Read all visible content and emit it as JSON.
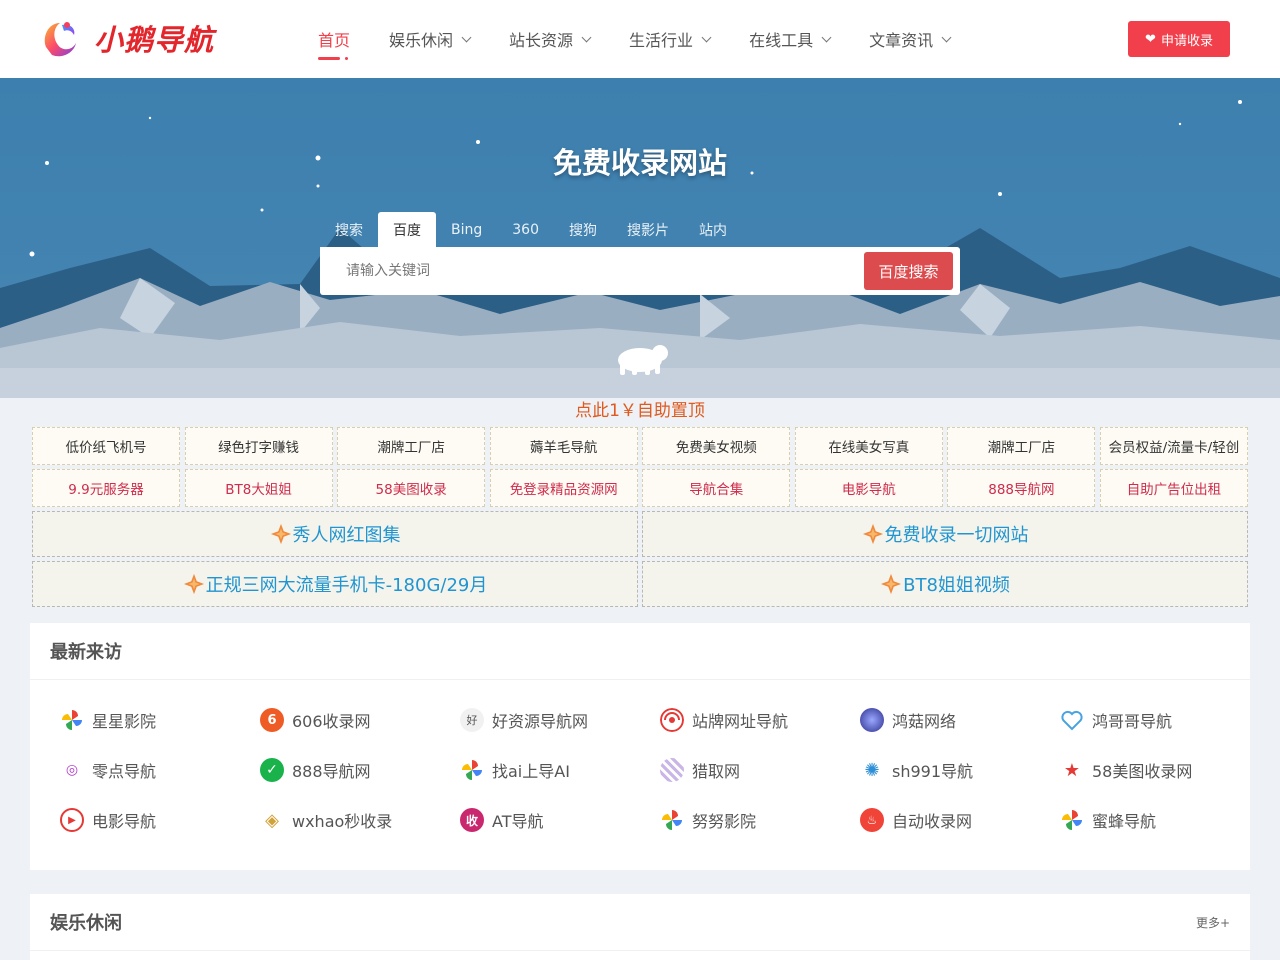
{
  "header": {
    "logo_text": "小鹅导航",
    "nav": [
      {
        "label": "首页",
        "active": true,
        "dropdown": false
      },
      {
        "label": "娱乐休闲",
        "active": false,
        "dropdown": true
      },
      {
        "label": "站长资源",
        "active": false,
        "dropdown": true
      },
      {
        "label": "生活行业",
        "active": false,
        "dropdown": true
      },
      {
        "label": "在线工具",
        "active": false,
        "dropdown": true
      },
      {
        "label": "文章资讯",
        "active": false,
        "dropdown": true
      }
    ],
    "apply_button": "申请收录"
  },
  "hero": {
    "title": "免费收录网站",
    "tabs": [
      "搜索",
      "百度",
      "Bing",
      "360",
      "搜狗",
      "搜影片",
      "站内"
    ],
    "active_tab": 1,
    "search_placeholder": "请输入关键词",
    "search_button": "百度搜索"
  },
  "promo": {
    "top_link": "点此1￥自助置顶",
    "row1": [
      "低价纸飞机号",
      "绿色打字赚钱",
      "潮牌工厂店",
      "薅羊毛导航",
      "免费美女视频",
      "在线美女写真",
      "潮牌工厂店",
      "会员权益/流量卡/轻创"
    ],
    "row2": [
      "9.9元服务器",
      "BT8大姐姐",
      "58美图收录",
      "免登录精品资源网",
      "导航合集",
      "电影导航",
      "888导航网",
      "自助广告位出租"
    ],
    "wide": [
      "秀人网红图集",
      "免费收录一切网站",
      "正规三网大流量手机卡-180G/29月",
      "BT8姐姐视频"
    ]
  },
  "visitors": {
    "title": "最新来访",
    "items": [
      {
        "label": "星星影院",
        "icon": "pinwheel-icon"
      },
      {
        "label": "606收录网",
        "icon": "six-badge-icon"
      },
      {
        "label": "好资源导航网",
        "icon": "brand-mark-icon"
      },
      {
        "label": "站牌网址导航",
        "icon": "swirl-icon"
      },
      {
        "label": "鸿菇网络",
        "icon": "galaxy-icon"
      },
      {
        "label": "鸿哥哥导航",
        "icon": "heart-outline-icon"
      },
      {
        "label": "零点导航",
        "icon": "owl-icon"
      },
      {
        "label": "888导航网",
        "icon": "check-badge-icon"
      },
      {
        "label": "找ai上导AI",
        "icon": "pinwheel-icon"
      },
      {
        "label": "猎取网",
        "icon": "pattern-icon"
      },
      {
        "label": "sh991导航",
        "icon": "sun-icon"
      },
      {
        "label": "58美图收录网",
        "icon": "star-icon"
      },
      {
        "label": "电影导航",
        "icon": "play-icon"
      },
      {
        "label": "wxhao秒收录",
        "icon": "diamond-icon"
      },
      {
        "label": "AT导航",
        "icon": "shou-badge-icon"
      },
      {
        "label": "努努影院",
        "icon": "pinwheel-icon"
      },
      {
        "label": "自动收录网",
        "icon": "flame-icon"
      },
      {
        "label": "蜜蜂导航",
        "icon": "pinwheel-icon"
      }
    ]
  },
  "entertainment": {
    "title": "娱乐休闲",
    "more": "更多+"
  },
  "colors": {
    "accent": "#f1404b",
    "hero_blue": "#4283b1",
    "link_blue": "#2195d1",
    "promo_red": "#d02c4d"
  }
}
